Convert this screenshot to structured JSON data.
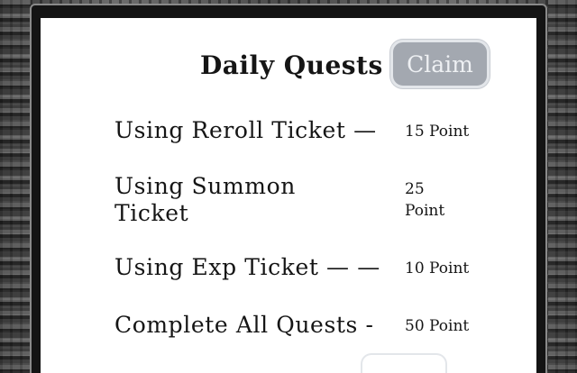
{
  "header": {
    "title": "Daily Quests",
    "claim_label": "Claim"
  },
  "quests": [
    {
      "name": "Using Reroll Ticket  —",
      "points": "15 Point"
    },
    {
      "name": "Using Summon Ticket",
      "points": "25 Point"
    },
    {
      "name": "Using Exp Ticket  — —",
      "points": "10 Point"
    },
    {
      "name": "Complete All Quests  -",
      "points": "50 Point"
    }
  ],
  "colors": {
    "panel": "#ffffff",
    "frame": "#141414",
    "claim_disabled": "#a3a8b0",
    "text": "#151515"
  }
}
